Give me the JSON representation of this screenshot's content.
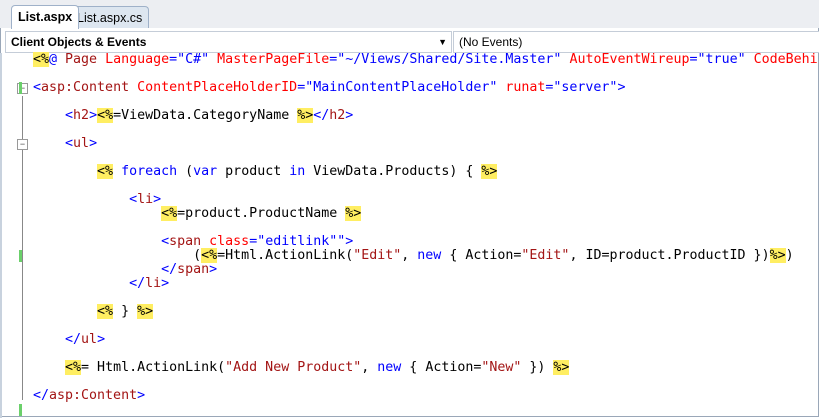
{
  "tabs": [
    {
      "label": "List.aspx",
      "active": true
    },
    {
      "label": "List.aspx.cs",
      "active": false
    }
  ],
  "dropdowns": {
    "objects": "Client Objects & Events",
    "events": "(No Events)"
  },
  "code": [
    {
      "indent": 0,
      "segs": [
        [
          "<%",
          "h"
        ],
        [
          "@",
          "k"
        ],
        [
          " Page",
          "m"
        ],
        [
          " Language",
          "r"
        ],
        [
          "=",
          "k"
        ],
        [
          "\"C#\"",
          "k"
        ],
        [
          " MasterPageFile",
          "r"
        ],
        [
          "=",
          "k"
        ],
        [
          "\"~/Views/Shared/Site.Master\"",
          "k"
        ],
        [
          " AutoEventWireup",
          "r"
        ],
        [
          "=",
          "k"
        ],
        [
          "\"true\"",
          "k"
        ],
        [
          " CodeBehi",
          "r"
        ]
      ]
    },
    {
      "indent": 0,
      "segs": []
    },
    {
      "indent": 0,
      "segs": [
        [
          "<",
          "k"
        ],
        [
          "asp:Content",
          "m"
        ],
        [
          " ContentPlaceHolderID",
          "r"
        ],
        [
          "=\"MainContentPlaceHolder\"",
          "k"
        ],
        [
          " runat",
          "r"
        ],
        [
          "=\"server\">",
          "k"
        ]
      ]
    },
    {
      "indent": 0,
      "segs": []
    },
    {
      "indent": 4,
      "segs": [
        [
          "<",
          "k"
        ],
        [
          "h2",
          "m"
        ],
        [
          ">",
          "k"
        ],
        [
          "<%",
          "h"
        ],
        [
          "=ViewData.CategoryName ",
          "p"
        ],
        [
          "%>",
          "h"
        ],
        [
          "</",
          "k"
        ],
        [
          "h2",
          "m"
        ],
        [
          ">",
          "k"
        ]
      ]
    },
    {
      "indent": 0,
      "segs": []
    },
    {
      "indent": 4,
      "segs": [
        [
          "<",
          "k"
        ],
        [
          "ul",
          "m"
        ],
        [
          ">",
          "k"
        ]
      ]
    },
    {
      "indent": 0,
      "segs": []
    },
    {
      "indent": 8,
      "segs": [
        [
          "<%",
          "h"
        ],
        [
          " ",
          "p"
        ],
        [
          "foreach",
          "k"
        ],
        [
          " (",
          "p"
        ],
        [
          "var",
          "k"
        ],
        [
          " product ",
          "p"
        ],
        [
          "in",
          "k"
        ],
        [
          " ViewData.Products) { ",
          "p"
        ],
        [
          "%>",
          "h"
        ]
      ]
    },
    {
      "indent": 0,
      "segs": []
    },
    {
      "indent": 12,
      "segs": [
        [
          "<",
          "k"
        ],
        [
          "li",
          "m"
        ],
        [
          ">",
          "k"
        ]
      ]
    },
    {
      "indent": 16,
      "segs": [
        [
          "<%",
          "h"
        ],
        [
          "=product.ProductName ",
          "p"
        ],
        [
          "%>",
          "h"
        ]
      ]
    },
    {
      "indent": 0,
      "segs": []
    },
    {
      "indent": 16,
      "segs": [
        [
          "<",
          "k"
        ],
        [
          "span",
          "m"
        ],
        [
          " class",
          "r"
        ],
        [
          "=\"editlink\"\">",
          "k"
        ]
      ]
    },
    {
      "indent": 20,
      "segs": [
        [
          "(",
          "p"
        ],
        [
          "<%",
          "h"
        ],
        [
          "=Html.ActionLink(",
          "p"
        ],
        [
          "\"Edit\"",
          "m"
        ],
        [
          ", ",
          "p"
        ],
        [
          "new",
          "k"
        ],
        [
          " { Action=",
          "p"
        ],
        [
          "\"Edit\"",
          "m"
        ],
        [
          ", ID=product.ProductID })",
          "p"
        ],
        [
          "%>",
          "h"
        ],
        [
          ")",
          "p"
        ]
      ]
    },
    {
      "indent": 16,
      "segs": [
        [
          "</",
          "k"
        ],
        [
          "span",
          "m"
        ],
        [
          ">",
          "k"
        ]
      ]
    },
    {
      "indent": 12,
      "segs": [
        [
          "</",
          "k"
        ],
        [
          "li",
          "m"
        ],
        [
          ">",
          "k"
        ]
      ]
    },
    {
      "indent": 0,
      "segs": []
    },
    {
      "indent": 8,
      "segs": [
        [
          "<%",
          "h"
        ],
        [
          " } ",
          "p"
        ],
        [
          "%>",
          "h"
        ]
      ]
    },
    {
      "indent": 0,
      "segs": []
    },
    {
      "indent": 4,
      "segs": [
        [
          "</",
          "k"
        ],
        [
          "ul",
          "m"
        ],
        [
          ">",
          "k"
        ]
      ]
    },
    {
      "indent": 0,
      "segs": []
    },
    {
      "indent": 4,
      "segs": [
        [
          "<%",
          "h"
        ],
        [
          "= Html.ActionLink(",
          "p"
        ],
        [
          "\"Add New Product\"",
          "m"
        ],
        [
          ", ",
          "p"
        ],
        [
          "new",
          "k"
        ],
        [
          " { Action=",
          "p"
        ],
        [
          "\"New\"",
          "m"
        ],
        [
          " }) ",
          "p"
        ],
        [
          "%>",
          "h"
        ]
      ]
    },
    {
      "indent": 0,
      "segs": []
    },
    {
      "indent": 0,
      "segs": [
        [
          "</",
          "k"
        ],
        [
          "asp:Content",
          "m"
        ],
        [
          ">",
          "k"
        ]
      ]
    }
  ]
}
